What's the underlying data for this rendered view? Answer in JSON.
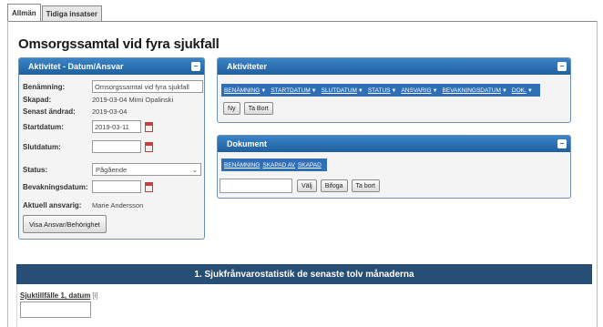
{
  "tabs": [
    {
      "label": "Allmän",
      "active": true
    },
    {
      "label": "Tidiga insatser",
      "active": false
    }
  ],
  "page_title": "Omsorgssamtal vid fyra sjukfall",
  "activity_panel": {
    "title": "Aktivitet - Datum/Ansvar",
    "collapse": "−",
    "fields": {
      "benamning_label": "Benämning:",
      "benamning_value": "Omsorgssamtal vid fyra sjukfall",
      "skapad_label": "Skapad:",
      "skapad_value": "2019-03-04 Mimi Opalinski",
      "senast_label": "Senast ändrad:",
      "senast_value": "2019-03-04",
      "startdatum_label": "Startdatum:",
      "startdatum_value": "2019-03-11",
      "slutdatum_label": "Slutdatum:",
      "slutdatum_value": "",
      "status_label": "Status:",
      "status_value": "Pågående",
      "bevakning_label": "Bevakningsdatum:",
      "bevakning_value": "",
      "ansvarig_label": "Aktuell ansvarig:",
      "ansvarig_value": "Marie Andersson"
    },
    "button": "Visa Ansvar/Behörighet"
  },
  "aktiviteter_panel": {
    "title": "Aktiviteter",
    "collapse": "−",
    "columns": [
      "BENÄMNING",
      "STARTDATUM",
      "SLUTDATUM",
      "STATUS",
      "ANSVARIG",
      "BEVAKNINGSDATUM",
      "DOK."
    ],
    "buttons": {
      "new": "Ny",
      "delete": "Ta Bort"
    }
  },
  "dokument_panel": {
    "title": "Dokument",
    "collapse": "−",
    "columns": [
      "BENÄMNING",
      "SKAPAD AV",
      "SKAPAD"
    ],
    "file_value": "",
    "buttons": {
      "choose": "Välj",
      "attach": "Bifoga",
      "delete": "Ta bort"
    }
  },
  "section": {
    "title": "1. Sjukfrånvarostatistik de senaste tolv månaderna",
    "field_label": "Sjuktillfälle 1, datum",
    "help": "[i]",
    "field_value": ""
  },
  "icons": {
    "calendar": "calendar-icon",
    "dropdown": "chevron-down-icon",
    "arrow": "triangle-down-icon"
  },
  "colors": {
    "panel_header": "#1f5f9e",
    "column_bar": "#2f6fb8",
    "section_bar": "#274e74",
    "calendar": "#c04040"
  }
}
